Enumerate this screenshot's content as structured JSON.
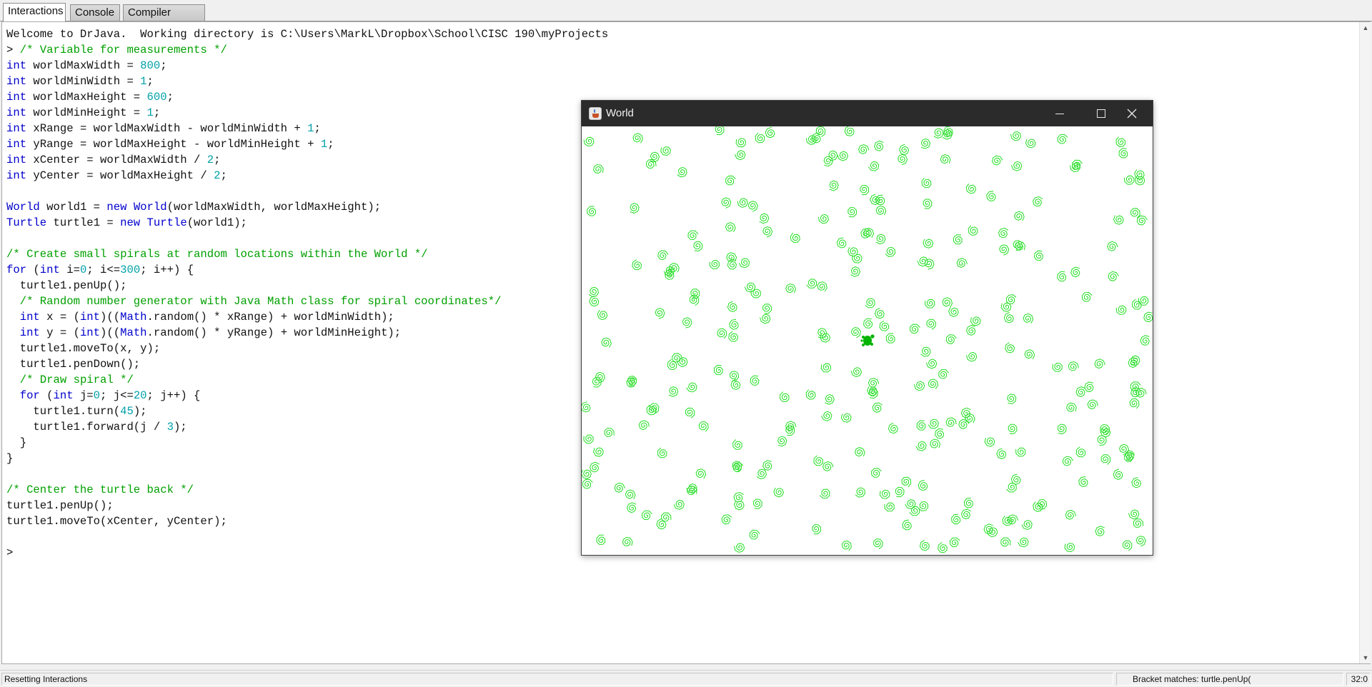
{
  "tabs": [
    {
      "label": "Interactions",
      "active": true
    },
    {
      "label": "Console",
      "active": false
    },
    {
      "label": "Compiler Output",
      "active": false
    }
  ],
  "code_lines": [
    [
      {
        "t": "Welcome to DrJava.  Working directory is C:\\Users\\MarkL\\Dropbox\\School\\CISC 190\\myProjects",
        "c": "plain"
      }
    ],
    [
      {
        "t": "> ",
        "c": "plain"
      },
      {
        "t": "/* Variable for measurements */",
        "c": "com"
      }
    ],
    [
      {
        "t": "int",
        "c": "kw"
      },
      {
        "t": " worldMaxWidth = ",
        "c": "plain"
      },
      {
        "t": "800",
        "c": "num"
      },
      {
        "t": ";",
        "c": "plain"
      }
    ],
    [
      {
        "t": "int",
        "c": "kw"
      },
      {
        "t": " worldMinWidth = ",
        "c": "plain"
      },
      {
        "t": "1",
        "c": "num"
      },
      {
        "t": ";",
        "c": "plain"
      }
    ],
    [
      {
        "t": "int",
        "c": "kw"
      },
      {
        "t": " worldMaxHeight = ",
        "c": "plain"
      },
      {
        "t": "600",
        "c": "num"
      },
      {
        "t": ";",
        "c": "plain"
      }
    ],
    [
      {
        "t": "int",
        "c": "kw"
      },
      {
        "t": " worldMinHeight = ",
        "c": "plain"
      },
      {
        "t": "1",
        "c": "num"
      },
      {
        "t": ";",
        "c": "plain"
      }
    ],
    [
      {
        "t": "int",
        "c": "kw"
      },
      {
        "t": " xRange = worldMaxWidth - worldMinWidth + ",
        "c": "plain"
      },
      {
        "t": "1",
        "c": "num"
      },
      {
        "t": ";",
        "c": "plain"
      }
    ],
    [
      {
        "t": "int",
        "c": "kw"
      },
      {
        "t": " yRange = worldMaxHeight - worldMinHeight + ",
        "c": "plain"
      },
      {
        "t": "1",
        "c": "num"
      },
      {
        "t": ";",
        "c": "plain"
      }
    ],
    [
      {
        "t": "int",
        "c": "kw"
      },
      {
        "t": " xCenter = worldMaxWidth / ",
        "c": "plain"
      },
      {
        "t": "2",
        "c": "num"
      },
      {
        "t": ";",
        "c": "plain"
      }
    ],
    [
      {
        "t": "int",
        "c": "kw"
      },
      {
        "t": " yCenter = worldMaxHeight / ",
        "c": "plain"
      },
      {
        "t": "2",
        "c": "num"
      },
      {
        "t": ";",
        "c": "plain"
      }
    ],
    [],
    [
      {
        "t": "World",
        "c": "kw"
      },
      {
        "t": " world1 = ",
        "c": "plain"
      },
      {
        "t": "new",
        "c": "kw"
      },
      {
        "t": " ",
        "c": "plain"
      },
      {
        "t": "World",
        "c": "kw"
      },
      {
        "t": "(worldMaxWidth, worldMaxHeight);",
        "c": "plain"
      }
    ],
    [
      {
        "t": "Turtle",
        "c": "kw"
      },
      {
        "t": " turtle1 = ",
        "c": "plain"
      },
      {
        "t": "new",
        "c": "kw"
      },
      {
        "t": " ",
        "c": "plain"
      },
      {
        "t": "Turtle",
        "c": "kw"
      },
      {
        "t": "(world1);",
        "c": "plain"
      }
    ],
    [],
    [
      {
        "t": "/* Create small spirals at random locations within the World */",
        "c": "com"
      }
    ],
    [
      {
        "t": "for",
        "c": "kw"
      },
      {
        "t": " (",
        "c": "plain"
      },
      {
        "t": "int",
        "c": "kw"
      },
      {
        "t": " i=",
        "c": "plain"
      },
      {
        "t": "0",
        "c": "num"
      },
      {
        "t": "; i<=",
        "c": "plain"
      },
      {
        "t": "300",
        "c": "num"
      },
      {
        "t": "; i++) {",
        "c": "plain"
      }
    ],
    [
      {
        "t": "  turtle1.penUp();",
        "c": "plain"
      }
    ],
    [
      {
        "t": "  ",
        "c": "plain"
      },
      {
        "t": "/* Random number generator with Java Math class for spiral coordinates*/",
        "c": "com"
      }
    ],
    [
      {
        "t": "  ",
        "c": "plain"
      },
      {
        "t": "int",
        "c": "kw"
      },
      {
        "t": " x = (",
        "c": "plain"
      },
      {
        "t": "int",
        "c": "kw"
      },
      {
        "t": ")((",
        "c": "plain"
      },
      {
        "t": "Math",
        "c": "kw"
      },
      {
        "t": ".random() * xRange) + worldMinWidth);",
        "c": "plain"
      }
    ],
    [
      {
        "t": "  ",
        "c": "plain"
      },
      {
        "t": "int",
        "c": "kw"
      },
      {
        "t": " y = (",
        "c": "plain"
      },
      {
        "t": "int",
        "c": "kw"
      },
      {
        "t": ")((",
        "c": "plain"
      },
      {
        "t": "Math",
        "c": "kw"
      },
      {
        "t": ".random() * yRange) + worldMinHeight);",
        "c": "plain"
      }
    ],
    [
      {
        "t": "  turtle1.moveTo(x, y);",
        "c": "plain"
      }
    ],
    [
      {
        "t": "  turtle1.penDown();",
        "c": "plain"
      }
    ],
    [
      {
        "t": "  ",
        "c": "plain"
      },
      {
        "t": "/* Draw spiral */",
        "c": "com"
      }
    ],
    [
      {
        "t": "  ",
        "c": "plain"
      },
      {
        "t": "for",
        "c": "kw"
      },
      {
        "t": " (",
        "c": "plain"
      },
      {
        "t": "int",
        "c": "kw"
      },
      {
        "t": " j=",
        "c": "plain"
      },
      {
        "t": "0",
        "c": "num"
      },
      {
        "t": "; j<=",
        "c": "plain"
      },
      {
        "t": "20",
        "c": "num"
      },
      {
        "t": "; j++) {",
        "c": "plain"
      }
    ],
    [
      {
        "t": "    turtle1.turn(",
        "c": "plain"
      },
      {
        "t": "45",
        "c": "num"
      },
      {
        "t": ");",
        "c": "plain"
      }
    ],
    [
      {
        "t": "    turtle1.forward(j / ",
        "c": "plain"
      },
      {
        "t": "3",
        "c": "num"
      },
      {
        "t": ");",
        "c": "plain"
      }
    ],
    [
      {
        "t": "  }",
        "c": "plain"
      }
    ],
    [
      {
        "t": "}",
        "c": "plain"
      }
    ],
    [],
    [
      {
        "t": "/* Center the turtle back */",
        "c": "com"
      }
    ],
    [
      {
        "t": "turtle1.penUp();",
        "c": "plain"
      }
    ],
    [
      {
        "t": "turtle1.moveTo(xCenter, yCenter);",
        "c": "plain"
      }
    ],
    [],
    [
      {
        "t": ">",
        "c": "plain"
      }
    ]
  ],
  "world_window": {
    "title": "World",
    "minimize_icon": "minimize-icon",
    "maximize_icon": "maximize-icon",
    "close_icon": "close-icon"
  },
  "status_bar": {
    "message": "Resetting Interactions",
    "bracket_match": "Bracket matches: turtle.penUp(",
    "position": "32:0"
  },
  "colors": {
    "keyword": "#0000cc",
    "comment": "#00a000",
    "number": "#00a0a8",
    "spiral": "#22dd22",
    "turtle": "#00b400"
  }
}
